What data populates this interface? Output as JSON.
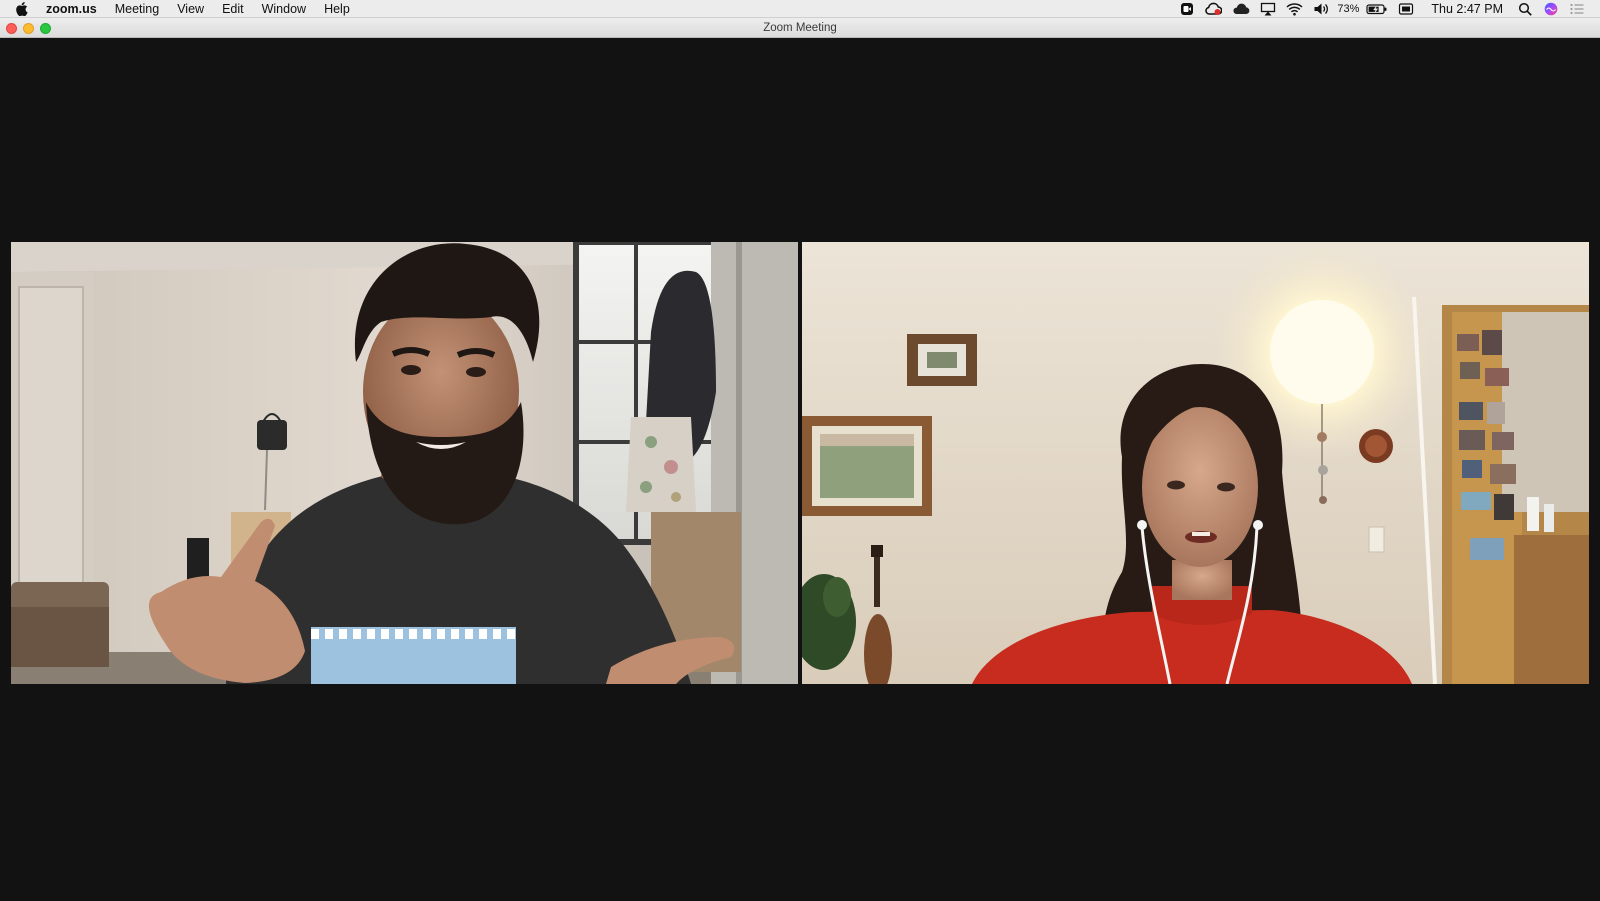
{
  "menubar": {
    "app_name": "zoom.us",
    "items": [
      "Meeting",
      "View",
      "Edit",
      "Window",
      "Help"
    ],
    "battery": "73%",
    "clock": "Thu 2:47 PM",
    "icons": [
      "apple-icon",
      "screen-record-icon",
      "creative-cloud-icon",
      "cloud-icon",
      "airplay-icon",
      "wifi-icon",
      "volume-icon",
      "battery-icon",
      "display-icon",
      "spotlight-icon",
      "siri-icon",
      "notification-center-icon"
    ]
  },
  "window": {
    "title": "Zoom Meeting"
  },
  "colors": {
    "meeting_background": "#121212",
    "menubar": "#ececec",
    "close": "#fc5f57",
    "minimize": "#fdbc2e",
    "maximize": "#29c840"
  }
}
